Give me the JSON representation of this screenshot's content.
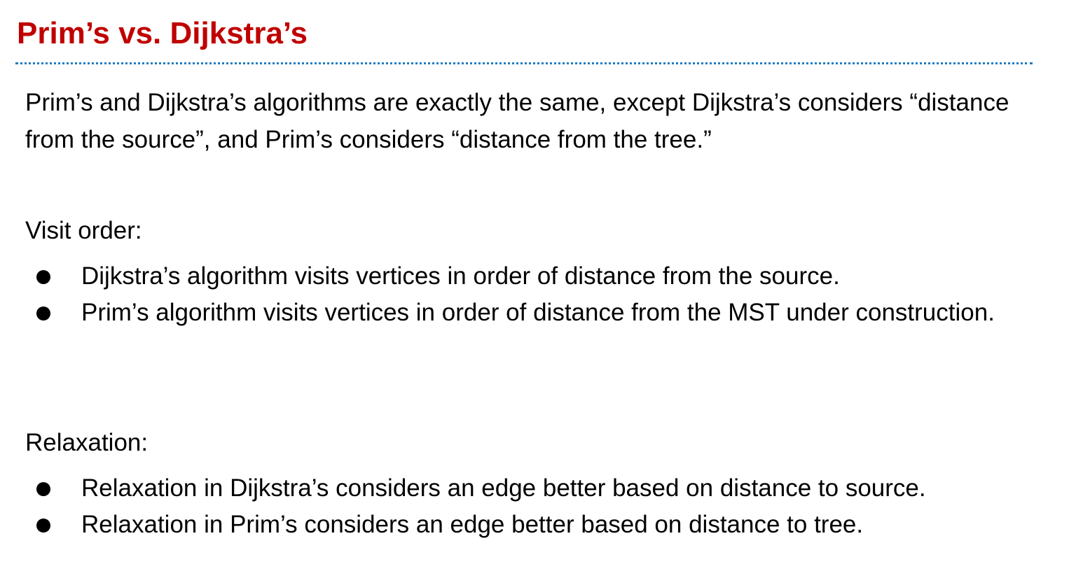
{
  "title": "Prim’s vs. Dijkstra’s",
  "intro": "Prim’s and Dijkstra’s algorithms are exactly the same, except Dijkstra’s considers “distance from the source”, and Prim’s considers “distance from the tree.”",
  "sections": [
    {
      "heading": "Visit order:",
      "bullets": [
        "Dijkstra’s algorithm visits vertices in order of distance from the source.",
        "Prim’s algorithm visits vertices in order of distance from the MST under construction."
      ]
    },
    {
      "heading": "Relaxation:",
      "bullets": [
        "Relaxation in Dijkstra’s considers an edge better based on distance to source.",
        "Relaxation in Prim’s considers an edge better based on distance to tree."
      ]
    }
  ],
  "colors": {
    "title": "#c00000",
    "divider": "#1f7cc0",
    "text": "#000000"
  }
}
